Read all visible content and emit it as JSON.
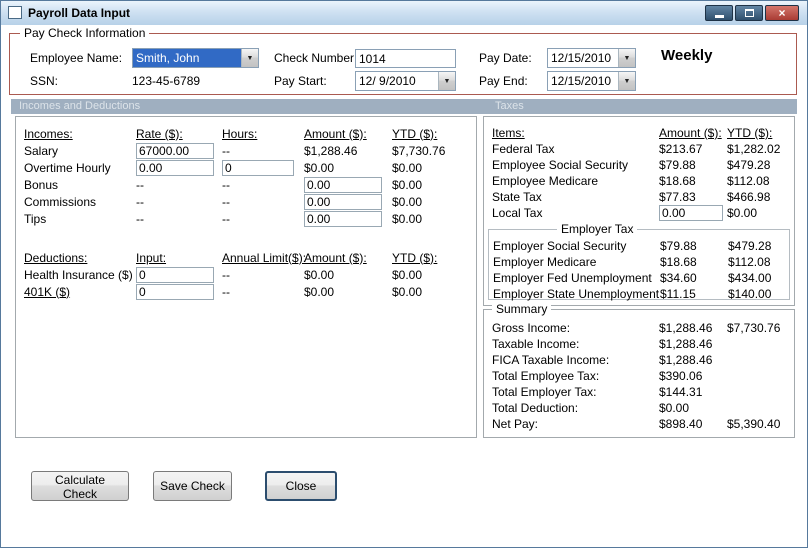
{
  "window": {
    "title": "Payroll Data Input"
  },
  "icons": {
    "close_glyph": "×",
    "dropdown_glyph": "▼"
  },
  "paycheck": {
    "group_title": "Pay Check Information",
    "employee_name_label": "Employee Name:",
    "employee_name_value": "Smith, John",
    "ssn_label": "SSN:",
    "ssn_value": "123-45-6789",
    "check_number_label": "Check Number:",
    "check_number_value": "1014",
    "pay_start_label": "Pay Start:",
    "pay_start_value": "12/ 9/2010",
    "pay_date_label": "Pay Date:",
    "pay_date_value": "12/15/2010",
    "pay_end_label": "Pay End:",
    "pay_end_value": "12/15/2010",
    "frequency": "Weekly"
  },
  "section_headers": {
    "incomes_deductions": "Incomes and Deductions",
    "taxes": "Taxes"
  },
  "incomes": {
    "headers": [
      "Incomes:",
      "Rate ($):",
      "Hours:",
      "Amount ($):",
      "YTD ($):"
    ],
    "rows": [
      {
        "label": "Salary",
        "rate": "67000.00",
        "hours": "--",
        "amount": "$1,288.46",
        "ytd": "$7,730.76"
      },
      {
        "label": "Overtime Hourly",
        "rate": "0.00",
        "hours": "0",
        "amount": "$0.00",
        "ytd": "$0.00"
      },
      {
        "label": "Bonus",
        "rate": "--",
        "hours": "--",
        "amount": "0.00",
        "ytd": "$0.00"
      },
      {
        "label": "Commissions",
        "rate": "--",
        "hours": "--",
        "amount": "0.00",
        "ytd": "$0.00"
      },
      {
        "label": "Tips",
        "rate": "--",
        "hours": "--",
        "amount": "0.00",
        "ytd": "$0.00"
      }
    ]
  },
  "deductions": {
    "headers": [
      "Deductions:",
      "Input:",
      "Annual Limit($):",
      "Amount ($):",
      "YTD ($):"
    ],
    "rows": [
      {
        "label": "Health Insurance ($)",
        "input": "0",
        "limit": "--",
        "amount": "$0.00",
        "ytd": "$0.00"
      },
      {
        "label": "401K ($)",
        "input": "0",
        "limit": "--",
        "amount": "$0.00",
        "ytd": "$0.00"
      }
    ]
  },
  "taxes": {
    "headers": [
      "Items:",
      "Amount ($):",
      "YTD ($):"
    ],
    "rows": [
      {
        "label": "Federal Tax",
        "amount": "$213.67",
        "ytd": "$1,282.02"
      },
      {
        "label": "Employee Social Security",
        "amount": "$79.88",
        "ytd": "$479.28"
      },
      {
        "label": "Employee Medicare",
        "amount": "$18.68",
        "ytd": "$112.08"
      },
      {
        "label": "State Tax",
        "amount": "$77.83",
        "ytd": "$466.98"
      },
      {
        "label": "Local Tax",
        "amount": "0.00",
        "ytd": "$0.00"
      }
    ],
    "employer_group_title": "Employer Tax",
    "employer_rows": [
      {
        "label": "Employer Social Security",
        "amount": "$79.88",
        "ytd": "$479.28"
      },
      {
        "label": "Employer Medicare",
        "amount": "$18.68",
        "ytd": "$112.08"
      },
      {
        "label": "Employer Fed Unemployment",
        "amount": "$34.60",
        "ytd": "$434.00"
      },
      {
        "label": "Employer State Unemployment",
        "amount": "$11.15",
        "ytd": "$140.00"
      }
    ]
  },
  "summary": {
    "group_title": "Summary",
    "rows": [
      {
        "label": "Gross Income:",
        "amount": "$1,288.46",
        "ytd": "$7,730.76"
      },
      {
        "label": "Taxable Income:",
        "amount": "$1,288.46",
        "ytd": ""
      },
      {
        "label": "FICA Taxable Income:",
        "amount": "$1,288.46",
        "ytd": ""
      },
      {
        "label": "Total Employee Tax:",
        "amount": "$390.06",
        "ytd": ""
      },
      {
        "label": "Total Employer Tax:",
        "amount": "$144.31",
        "ytd": ""
      },
      {
        "label": "Total Deduction:",
        "amount": "$0.00",
        "ytd": ""
      },
      {
        "label": "Net Pay:",
        "amount": "$898.40",
        "ytd": "$5,390.40"
      }
    ]
  },
  "buttons": {
    "calculate": "Calculate Check",
    "save": "Save Check",
    "close": "Close"
  }
}
